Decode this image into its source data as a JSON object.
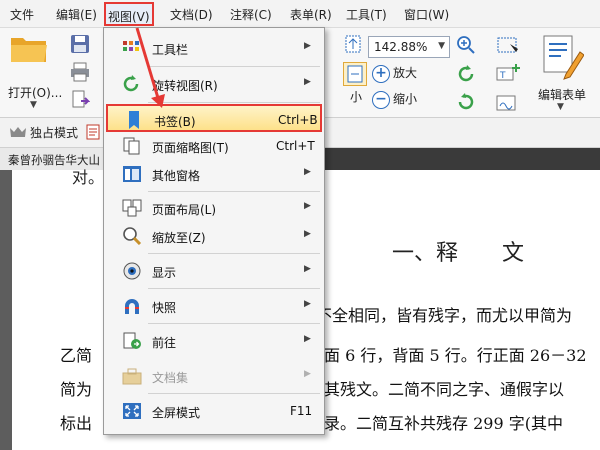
{
  "menubar": {
    "items": [
      "文件",
      "编辑(E)",
      "视图(V)",
      "文档(D)",
      "注释(C)",
      "表单(R)",
      "工具(T)",
      "窗口(W)"
    ]
  },
  "toolbar": {
    "open_label": "打开(O)...",
    "zoom_value": "142.88%",
    "zoom_in_label": "放大",
    "zoom_out_label": "缩小",
    "small_label": "小",
    "edit_form_label": "编辑表单",
    "focus_mode_label": "独占模式"
  },
  "document": {
    "tab_title": "秦曾孙骃告华大山",
    "top_fragment": "对。",
    "heading": "一、释　　文",
    "lines": [
      "不全相同，皆有残字，而尤以甲简为",
      "乙简",
      "面 6 行，背面 5 行。行正面 26－32",
      "简为",
      "其残文。二简不同之字、通假字以",
      "标出",
      "录。二简互补共残存 299 字(其中"
    ]
  },
  "view_menu": {
    "items": [
      {
        "label": "工具栏",
        "shortcut": "",
        "submenu": true,
        "icon": "toolbar-grid-icon"
      },
      {
        "label": "旋转视图(R)",
        "shortcut": "",
        "submenu": true,
        "icon": "rotate-view-icon"
      },
      {
        "label": "书签(B)",
        "shortcut": "Ctrl+B",
        "submenu": false,
        "icon": "bookmark-icon"
      },
      {
        "label": "页面缩略图(T)",
        "shortcut": "Ctrl+T",
        "submenu": false,
        "icon": "page-thumbnails-icon"
      },
      {
        "label": "其他窗格",
        "shortcut": "",
        "submenu": true,
        "icon": "panes-icon"
      },
      {
        "label": "页面布局(L)",
        "shortcut": "",
        "submenu": true,
        "icon": "page-layout-icon"
      },
      {
        "label": "缩放至(Z)",
        "shortcut": "",
        "submenu": true,
        "icon": "zoom-magnifier-icon"
      },
      {
        "label": "显示",
        "shortcut": "",
        "submenu": true,
        "icon": "display-eye-icon"
      },
      {
        "label": "快照",
        "shortcut": "",
        "submenu": true,
        "icon": "snapshot-icon"
      },
      {
        "label": "前往",
        "shortcut": "",
        "submenu": true,
        "icon": "goto-page-icon"
      },
      {
        "label": "文档集",
        "shortcut": "",
        "submenu": true,
        "icon": "document-set-icon"
      },
      {
        "label": "全屏模式",
        "shortcut": "F11",
        "submenu": false,
        "icon": "fullscreen-icon"
      }
    ],
    "highlighted_index": 2,
    "disabled_index": 10
  },
  "colors": {
    "highlight_border": "#e53935",
    "accent_blue": "#2f6fbf",
    "menu_bg": "#f5f5f5"
  }
}
